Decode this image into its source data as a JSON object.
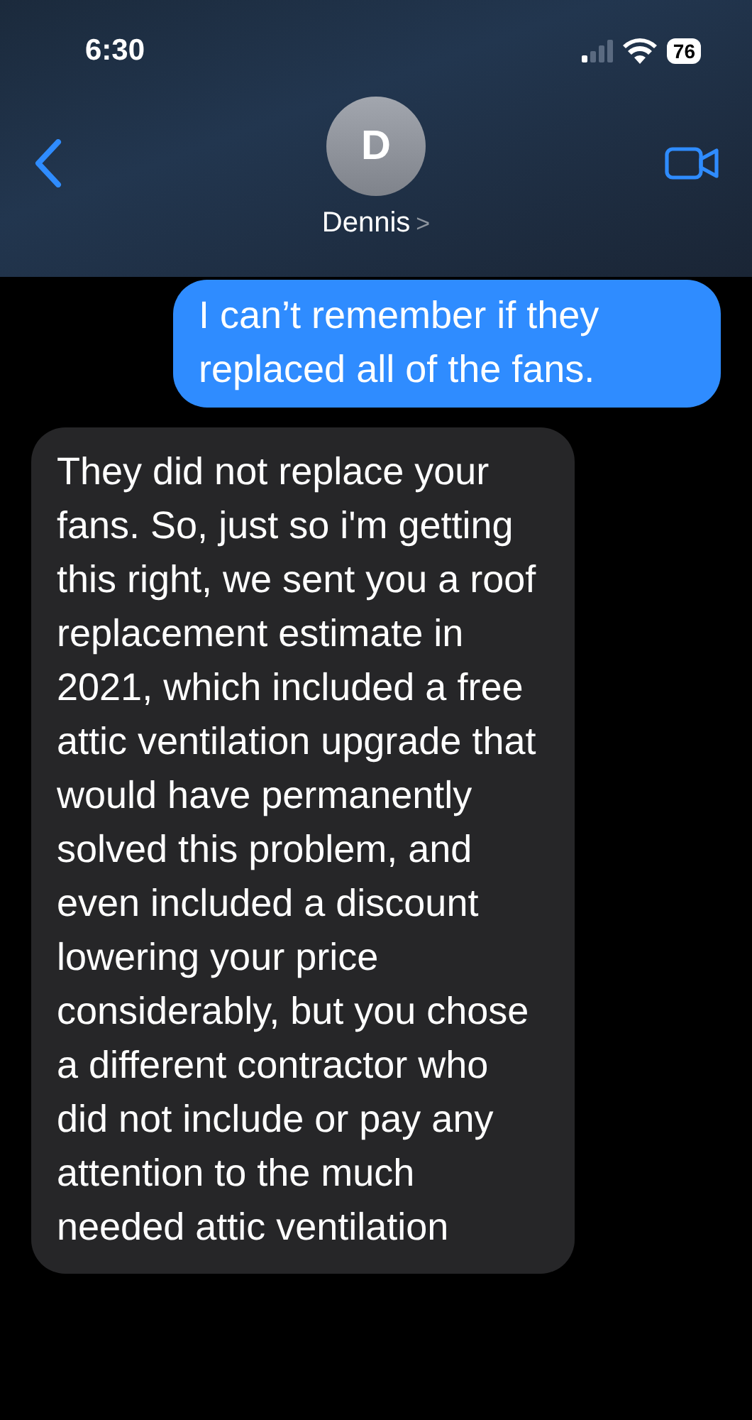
{
  "status_bar": {
    "time": "6:30",
    "battery": "76"
  },
  "header": {
    "avatar_initial": "D",
    "contact_name": "Dennis",
    "chevron": ">"
  },
  "messages": [
    {
      "kind": "sent",
      "text": "I can’t remember if they replaced all of the fans."
    },
    {
      "kind": "received",
      "text": "They did not replace your fans. So, just so i'm getting this right, we sent you a roof replacement estimate in 2021, which included a free attic ventilation upgrade that would have permanently solved this problem, and even included a discount lowering your price considerably, but you chose a different contractor who did not include or pay any attention to the much needed attic ventilation"
    }
  ]
}
